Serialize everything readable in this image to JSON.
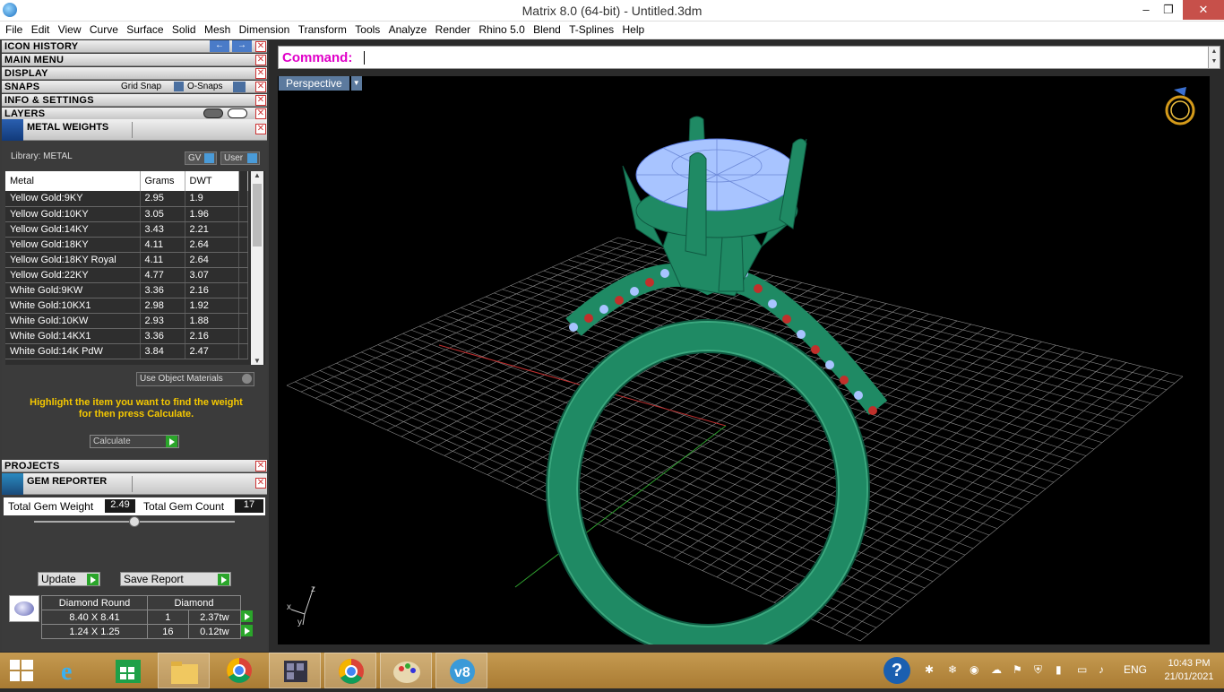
{
  "window": {
    "title": "Matrix 8.0 (64-bit) - Untitled.3dm",
    "minimize": "–",
    "maximize": "❐",
    "close": "✕"
  },
  "menu": [
    "File",
    "Edit",
    "View",
    "Curve",
    "Surface",
    "Solid",
    "Mesh",
    "Dimension",
    "Transform",
    "Tools",
    "Analyze",
    "Render",
    "Rhino 5.0",
    "Blend",
    "T-Splines",
    "Help"
  ],
  "panels": {
    "icon_history": "ICON HISTORY",
    "main_menu": "MAIN MENU",
    "display": "DISPLAY",
    "snaps": "SNAPS",
    "grid_snap": "Grid Snap",
    "o_snaps": "O-Snaps",
    "info_settings": "INFO & SETTINGS",
    "layers": "LAYERS",
    "metal_weights": "METAL WEIGHTS",
    "projects": "PROJECTS",
    "gem_reporter": "GEM REPORTER",
    "close_glyph": "✕"
  },
  "metal_weights": {
    "library": "Library: METAL",
    "gv": "GV",
    "user": "User",
    "columns": [
      "Metal",
      "Grams",
      "DWT"
    ],
    "rows": [
      [
        "Yellow Gold:9KY",
        "2.95",
        "1.9"
      ],
      [
        "Yellow Gold:10KY",
        "3.05",
        "1.96"
      ],
      [
        "Yellow Gold:14KY",
        "3.43",
        "2.21"
      ],
      [
        "Yellow Gold:18KY",
        "4.11",
        "2.64"
      ],
      [
        "Yellow Gold:18KY Royal",
        "4.11",
        "2.64"
      ],
      [
        "Yellow Gold:22KY",
        "4.77",
        "3.07"
      ],
      [
        "White Gold:9KW",
        "3.36",
        "2.16"
      ],
      [
        "White Gold:10KX1",
        "2.98",
        "1.92"
      ],
      [
        "White Gold:10KW",
        "2.93",
        "1.88"
      ],
      [
        "White Gold:14KX1",
        "3.36",
        "2.16"
      ],
      [
        "White Gold:14K PdW",
        "3.84",
        "2.47"
      ]
    ],
    "use_object_materials": "Use Object Materials",
    "hint_line1": "Highlight the item you want to find the weight",
    "hint_line2": "for then press Calculate.",
    "calculate": "Calculate"
  },
  "gem_reporter": {
    "total_weight_label": "Total Gem Weight",
    "total_weight": "2.49",
    "total_count_label": "Total Gem Count",
    "total_count": "17",
    "update": "Update",
    "save_report": "Save Report",
    "headers": [
      "Diamond Round",
      "Diamond"
    ],
    "rows": [
      [
        "8.40 X 8.41",
        "1",
        "2.37tw"
      ],
      [
        "1.24 X 1.25",
        "16",
        "0.12tw"
      ]
    ]
  },
  "command": {
    "label": "Command:",
    "scroll_up": "▲",
    "scroll_down": "▼"
  },
  "viewport": {
    "name": "Perspective",
    "axis_x": "x",
    "axis_y": "y",
    "axis_z": "z",
    "dropdown": "▼"
  },
  "taskbar": {
    "time": "10:43 PM",
    "date": "21/01/2021",
    "lang": "ENG"
  },
  "colors": {
    "command": "#e000c8",
    "hint": "#f5c800",
    "band": "#1a7a5a",
    "stone": "#a8c4ff",
    "accent_red": "#c0302b"
  }
}
